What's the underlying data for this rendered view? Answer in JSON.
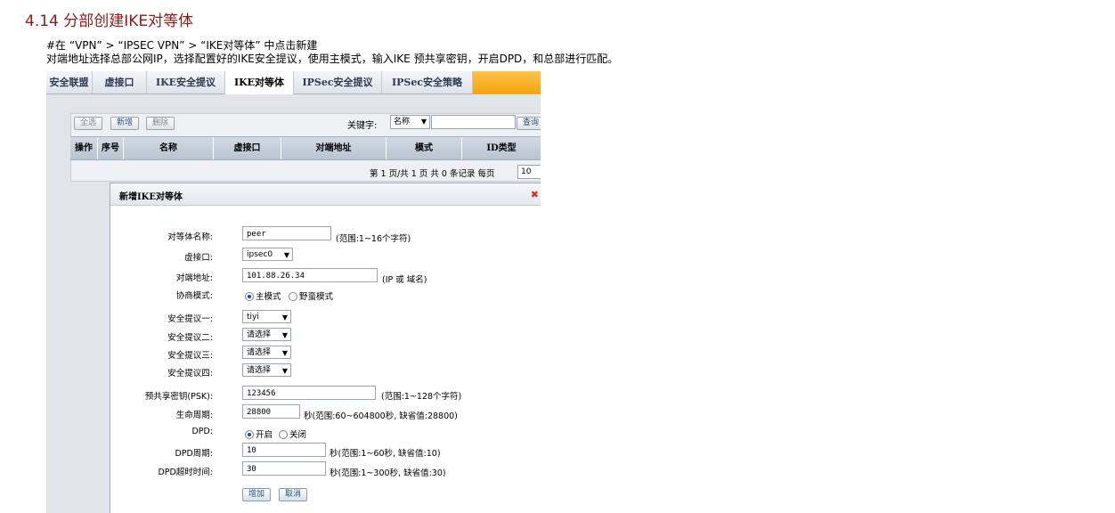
{
  "doc": {
    "heading": "4.14  分部创建IKE对等体",
    "line1": "#在 “VPN” > “IPSEC VPN” > “IKE对等体” 中点击新建",
    "line2": "对端地址选择总部公网IP，选择配置好的IKE安全提议，使用主模式，输入IKE 预共享密钥，开启DPD，和总部进行匹配。"
  },
  "tabs": [
    "安全联盟",
    "虚接口",
    "IKE安全提议",
    "IKE对等体",
    "IPSec安全提议",
    "IPSec安全策略"
  ],
  "active_tab": "IKE对等体",
  "toolbar": {
    "select_all": "全选",
    "new": "新增",
    "delete": "删除",
    "keyword_label": "关键字:",
    "keyword_field": "名称",
    "search": "查询"
  },
  "table": {
    "headers": [
      "操作",
      "序号",
      "名称",
      "虚接口",
      "对端地址",
      "模式",
      "ID类型"
    ]
  },
  "pager": {
    "text": "第 1 页/共 1 页 共 0 条记录 每页",
    "per_page": "10"
  },
  "dialog": {
    "title": "新增IKE对等体",
    "close": "✖",
    "fields": {
      "name_label": "对等体名称:",
      "name_value": "peer",
      "name_hint": "(范围:1~16个字符)",
      "iface_label": "虚接口:",
      "iface_value": "ipsec0",
      "addr_label": "对端地址:",
      "addr_value": "101.88.26.34",
      "addr_hint": "(IP 或 域名)",
      "mode_label": "协商模式:",
      "mode_main": "主模式",
      "mode_aggr": "野蛮模式",
      "p1_label": "安全提议一:",
      "p1_value": "tiyi",
      "p2_label": "安全提议二:",
      "p2_value": "请选择",
      "p3_label": "安全提议三:",
      "p3_value": "请选择",
      "p4_label": "安全提议四:",
      "p4_value": "请选择",
      "psk_label": "预共享密钥(PSK):",
      "psk_value": "123456",
      "psk_hint": "(范围:1~128个字符)",
      "life_label": "生命周期:",
      "life_value": "28800",
      "life_hint": "秒(范围:60~604800秒, 缺省值:28800)",
      "dpd_label": "DPD:",
      "dpd_on": "开启",
      "dpd_off": "关闭",
      "dpdp_label": "DPD周期:",
      "dpdp_value": "10",
      "dpdp_hint": "秒(范围:1~60秒, 缺省值:10)",
      "dpdt_label": "DPD超时时间:",
      "dpdt_value": "30",
      "dpdt_hint": "秒(范围:1~300秒, 缺省值:30)"
    },
    "buttons": {
      "add": "增加",
      "cancel": "取消"
    }
  }
}
